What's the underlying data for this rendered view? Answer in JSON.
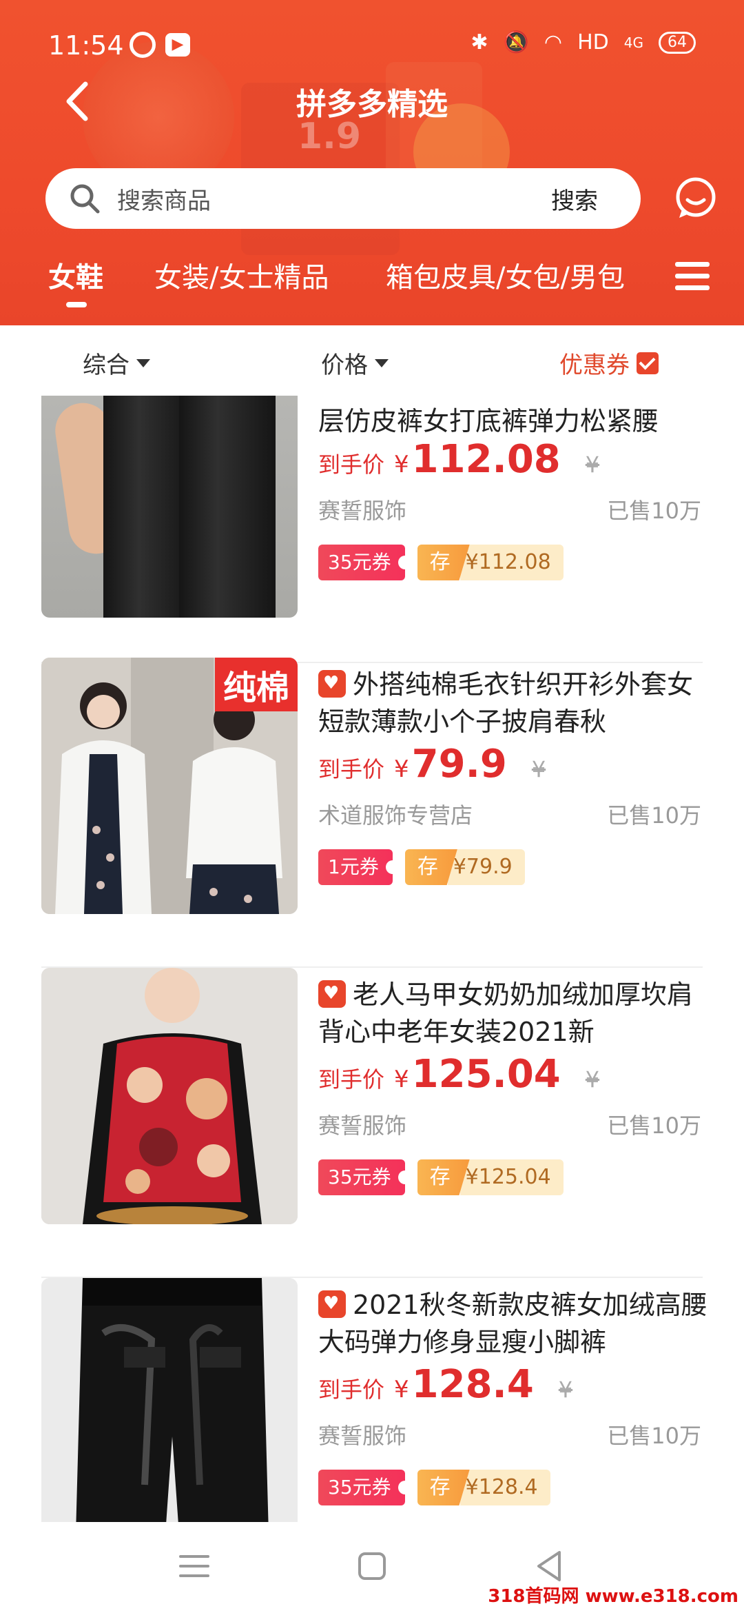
{
  "status_bar": {
    "time": "11:54",
    "network": "HD",
    "signal": "4G",
    "battery": "64"
  },
  "header": {
    "title": "拼多多精选",
    "decor_number": "1.9"
  },
  "search": {
    "placeholder": "搜索商品",
    "button_label": "搜索"
  },
  "categories": [
    {
      "label": "女鞋",
      "active": true
    },
    {
      "label": "女装/女士精品",
      "active": false
    },
    {
      "label": "箱包皮具/女包/男包",
      "active": false
    }
  ],
  "sort": {
    "comprehensive": "综合",
    "price": "价格",
    "coupon": "优惠券",
    "coupon_checked": true
  },
  "products": [
    {
      "title": "层仿皮裤女打底裤弹力松紧腰",
      "price_label": "到手价",
      "currency": "¥",
      "price": "112.08",
      "orig_currency": "¥",
      "shop": "赛誓服饰",
      "sold": "已售10万",
      "coupon": "35元券",
      "save_label": "存",
      "save_value": "¥112.08"
    },
    {
      "title": "外搭纯棉毛衣针织开衫外套女短款薄款小个子披肩春秋",
      "badge": "纯棉",
      "price_label": "到手价",
      "currency": "¥",
      "price": "79.9",
      "orig_currency": "¥",
      "shop": "术道服饰专营店",
      "sold": "已售10万",
      "coupon": "1元券",
      "save_label": "存",
      "save_value": "¥79.9"
    },
    {
      "title": "老人马甲女奶奶加绒加厚坎肩背心中老年女装2021新",
      "price_label": "到手价",
      "currency": "¥",
      "price": "125.04",
      "orig_currency": "¥",
      "shop": "赛誓服饰",
      "sold": "已售10万",
      "coupon": "35元券",
      "save_label": "存",
      "save_value": "¥125.04"
    },
    {
      "title": "2021秋冬新款皮裤女加绒高腰大码弹力修身显瘦小脚裤",
      "price_label": "到手价",
      "currency": "¥",
      "price": "128.4",
      "orig_currency": "¥",
      "shop": "赛誓服饰",
      "sold": "已售10万",
      "coupon": "35元券",
      "save_label": "存",
      "save_value": "¥128.4"
    }
  ],
  "watermark": "318首码网 www.e318.com",
  "colors": {
    "brand": "#ee4a2c",
    "price": "#e02d2d",
    "coupon_bg": "#f4315a",
    "save_bg": "#f79b3d"
  }
}
